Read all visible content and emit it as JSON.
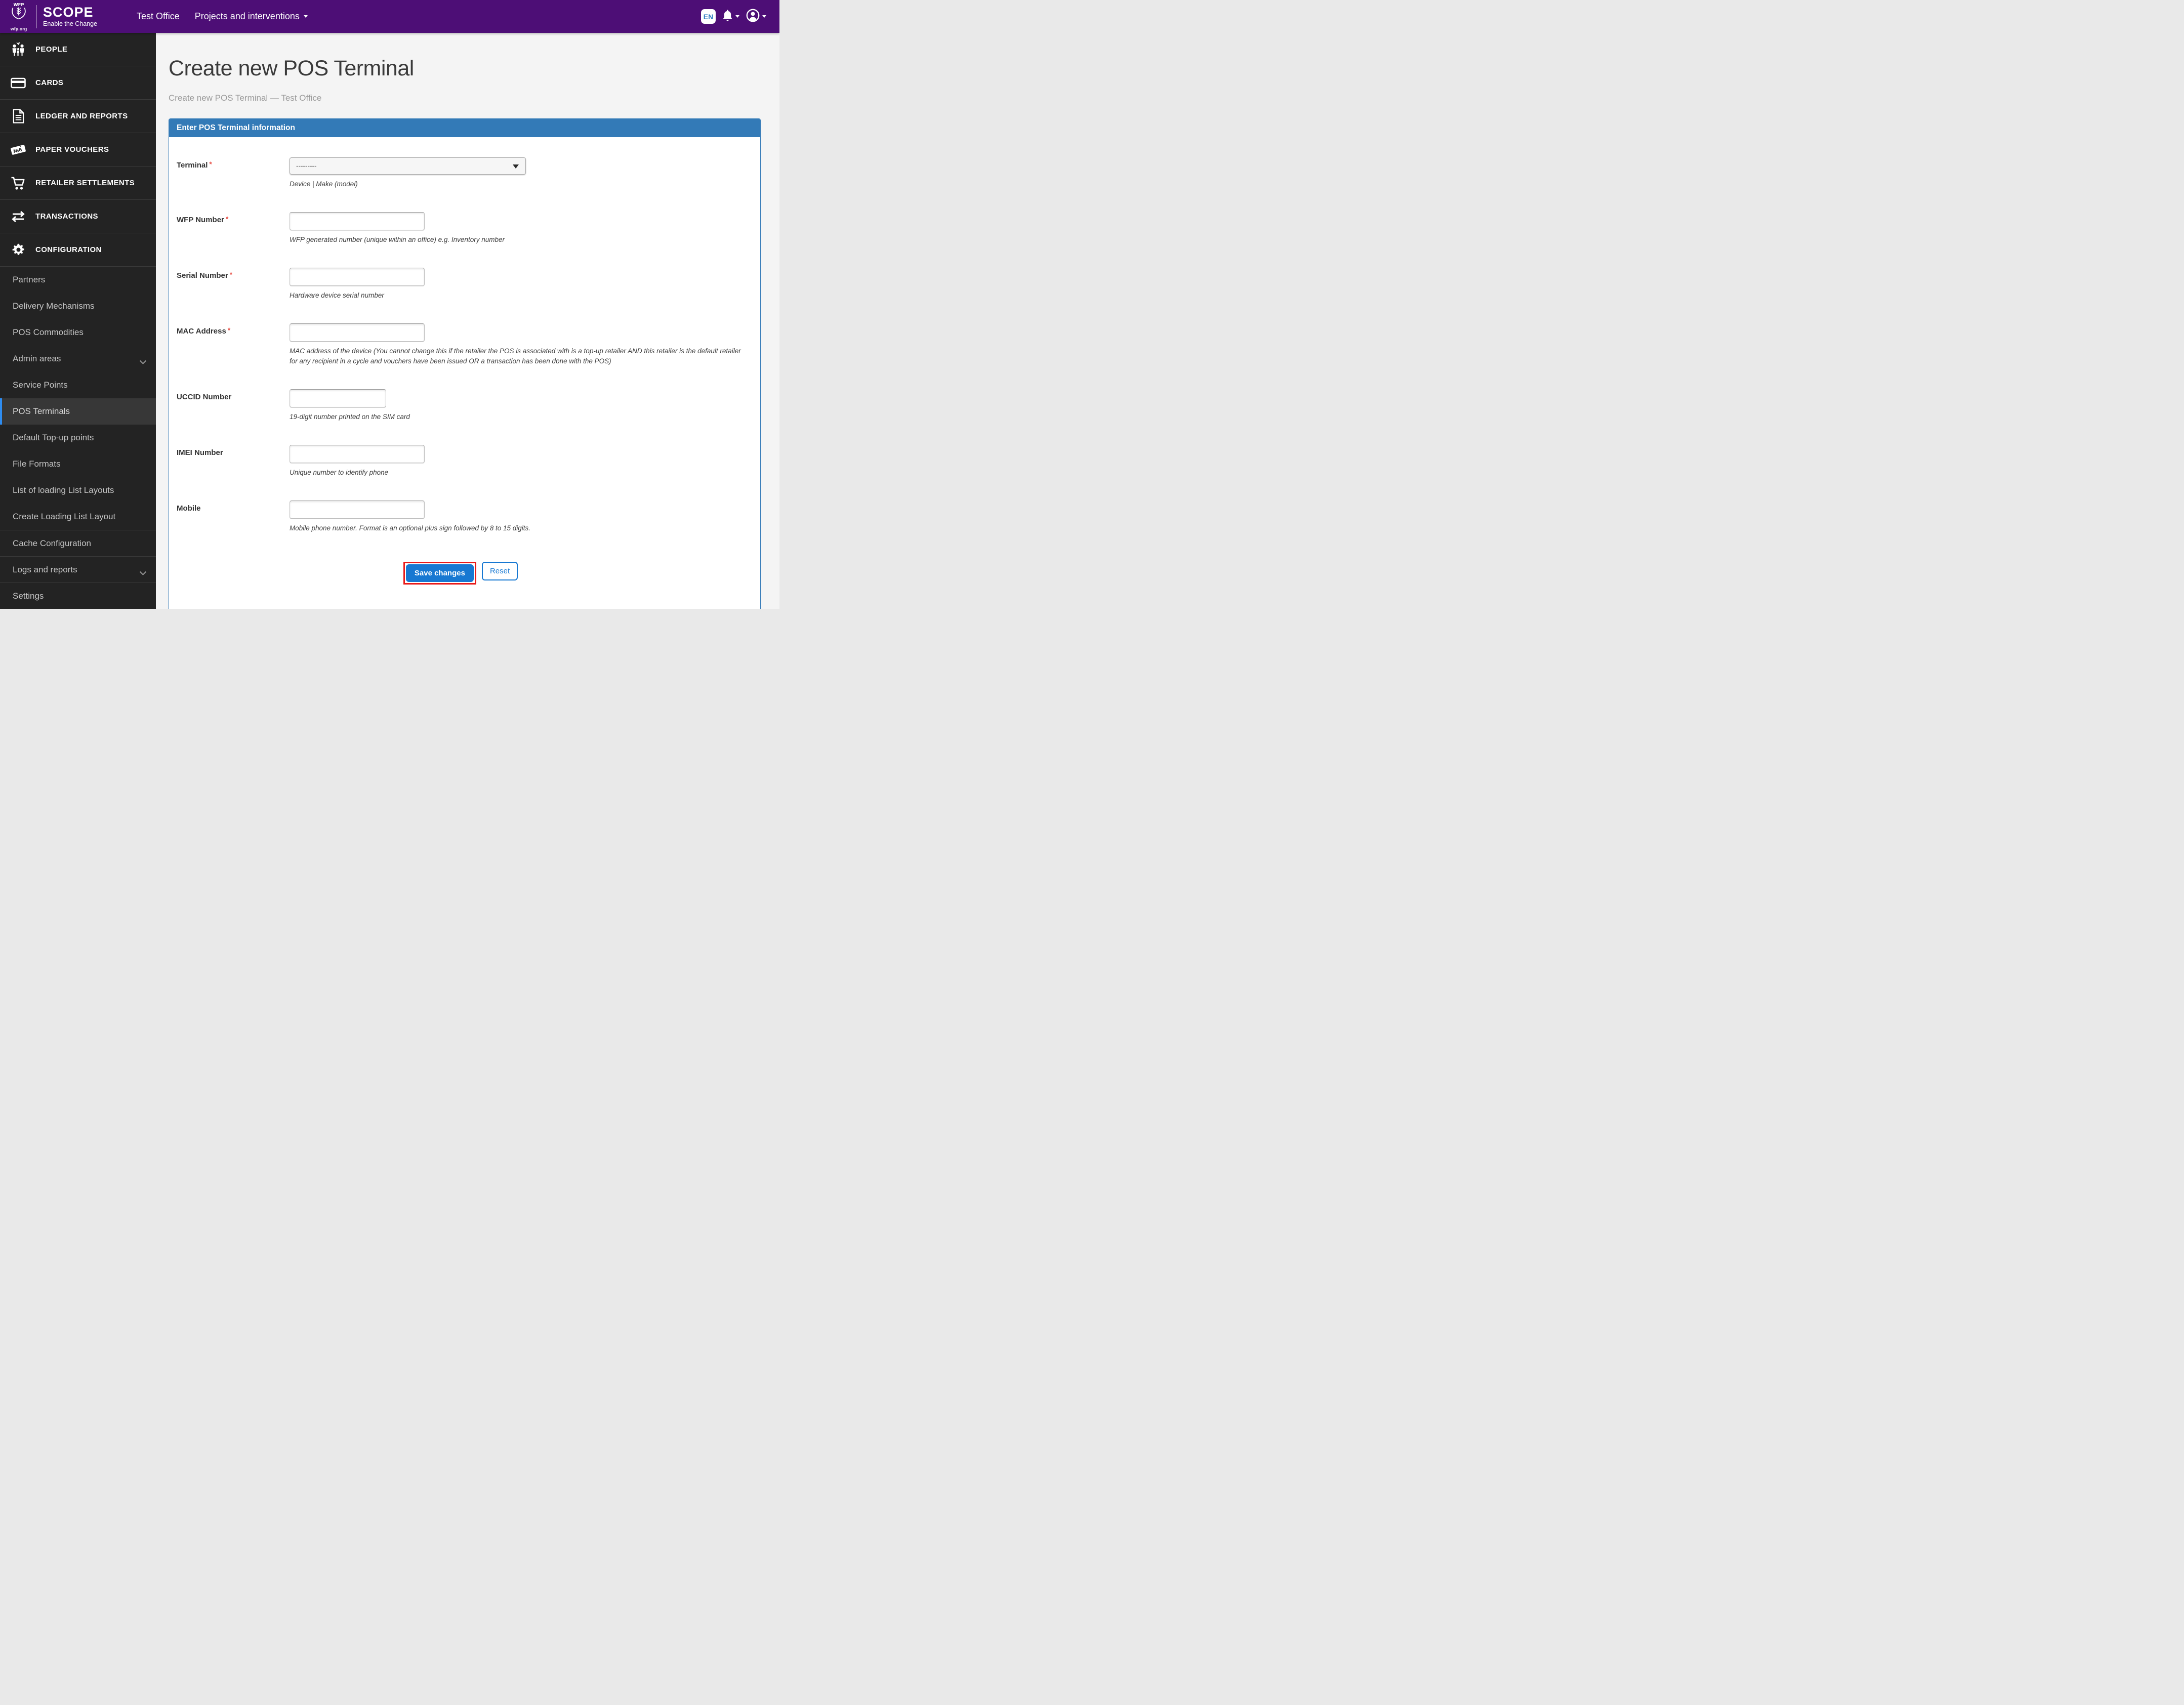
{
  "topbar": {
    "logo": {
      "org": "WFP",
      "product": "SCOPE",
      "tagline": "Enable the Change",
      "site": "wfp.org"
    },
    "nav": [
      {
        "label": "Test Office"
      },
      {
        "label": "Projects and interventions"
      }
    ],
    "language_badge": "EN"
  },
  "sidebar": {
    "sections": [
      {
        "label": "PEOPLE",
        "icon": "people-icon"
      },
      {
        "label": "CARDS",
        "icon": "cards-icon"
      },
      {
        "label": "LEDGER AND REPORTS",
        "icon": "document-icon"
      },
      {
        "label": "PAPER VOUCHERS",
        "icon": "ticket-icon"
      },
      {
        "label": "RETAILER SETTLEMENTS",
        "icon": "cart-icon"
      },
      {
        "label": "TRANSACTIONS",
        "icon": "transfer-arrows-icon"
      },
      {
        "label": "CONFIGURATION",
        "icon": "gear-icon"
      }
    ],
    "config_items": [
      {
        "label": "Partners"
      },
      {
        "label": "Delivery Mechanisms"
      },
      {
        "label": "POS Commodities"
      },
      {
        "label": "Admin areas",
        "expandable": true
      },
      {
        "label": "Service Points"
      },
      {
        "label": "POS Terminals",
        "active": true
      },
      {
        "label": "Default Top-up points"
      },
      {
        "label": "File Formats"
      },
      {
        "label": "List of loading List Layouts"
      },
      {
        "label": "Create Loading List Layout"
      },
      {
        "label": "Cache Configuration",
        "divided": true
      },
      {
        "label": "Logs and reports",
        "divided": true,
        "expandable": true
      },
      {
        "label": "Settings",
        "divided": true
      }
    ]
  },
  "page": {
    "title": "Create new POS Terminal",
    "breadcrumb": "Create new POS Terminal — Test Office"
  },
  "form": {
    "legend": "Enter POS Terminal information",
    "required_marker": "*",
    "fields": [
      {
        "label": "Terminal",
        "required": true,
        "type": "select",
        "value": "---------",
        "helper": "Device | Make (model)"
      },
      {
        "label": "WFP Number",
        "required": true,
        "type": "text",
        "value": "",
        "helper": "WFP generated number (unique within an office) e.g. Inventory number"
      },
      {
        "label": "Serial Number",
        "required": true,
        "type": "text",
        "value": "",
        "helper": "Hardware device serial number"
      },
      {
        "label": "MAC Address",
        "required": true,
        "type": "text",
        "value": "",
        "helper": "MAC address of the device (You cannot change this if the retailer the POS is associated with is a top-up retailer AND this retailer is the default retailer for any recipient in a cycle and vouchers have been issued OR a transaction has been done with the POS)"
      },
      {
        "label": "UCCID Number",
        "required": false,
        "type": "text",
        "value": "",
        "helper": "19-digit number printed on the SIM card",
        "small": true
      },
      {
        "label": "IMEI Number",
        "required": false,
        "type": "text",
        "value": "",
        "helper": "Unique number to identify phone"
      },
      {
        "label": "Mobile",
        "required": false,
        "type": "text",
        "value": "",
        "helper": "Mobile phone number. Format is an optional plus sign followed by 8 to 15 digits."
      }
    ],
    "buttons": {
      "save": "Save changes",
      "reset": "Reset"
    }
  },
  "colors": {
    "topbar_purple": "#4d0e76",
    "sidebar_dark": "#232323",
    "panel_header_blue": "#337ab7",
    "button_blue": "#1778d2",
    "active_item_blue": "#2e8cf0",
    "annotation_red": "#e81a1a",
    "required_red": "#e8544b"
  }
}
